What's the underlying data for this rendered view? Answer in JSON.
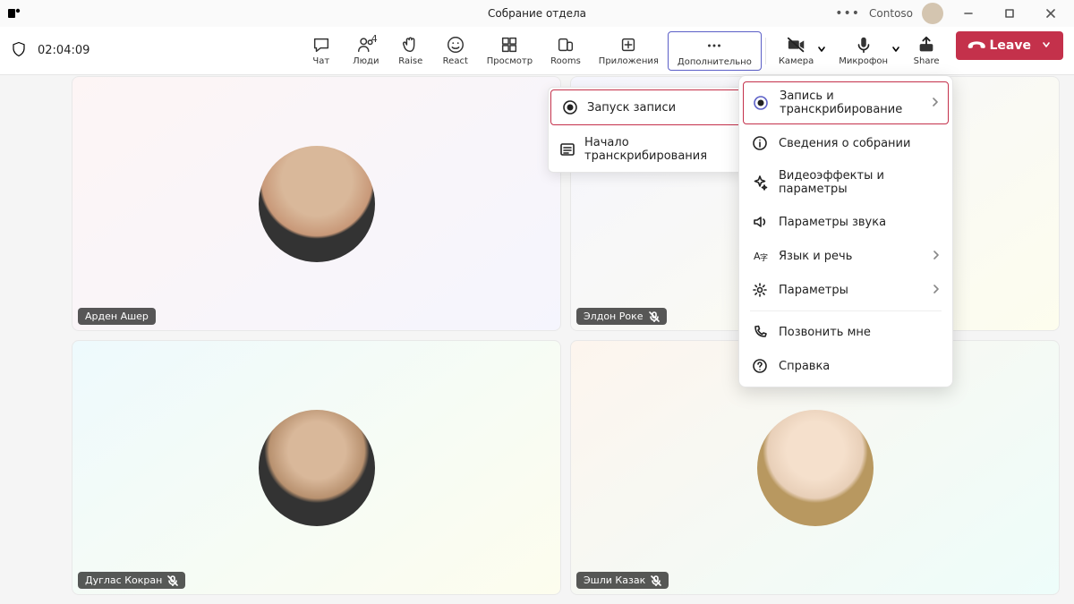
{
  "title_bar": {
    "meeting_title": "Собрание отдела",
    "org": "Contoso"
  },
  "toolbar": {
    "timer": "02:04:09",
    "chat": "Чат",
    "people": "Люди",
    "people_count": "4",
    "raise": "Raise",
    "react": "React",
    "view": "Просмотр",
    "rooms": "Rooms",
    "apps": "Приложения",
    "more": "Дополнительно",
    "camera": "Камера",
    "mic": "Микрофон",
    "share": "Share",
    "leave": "Leave"
  },
  "submenu": {
    "start_recording": "Запуск записи",
    "start_transcription": "Начало транскрибирования"
  },
  "more_menu": {
    "record_transcribe": "Запись и транскрибирование",
    "meeting_info": "Сведения о собрании",
    "video_effects": "Видеоэффекты и параметры",
    "audio_settings": "Параметры звука",
    "language_speech": "Язык и речь",
    "settings": "Параметры",
    "call_me": "Позвонить мне",
    "help": "Справка"
  },
  "participants": {
    "p1": "Арден Ашер",
    "p2": "Элдон Роке",
    "p3": "Дуглас Кокран",
    "p4": "Эшли Казак"
  }
}
